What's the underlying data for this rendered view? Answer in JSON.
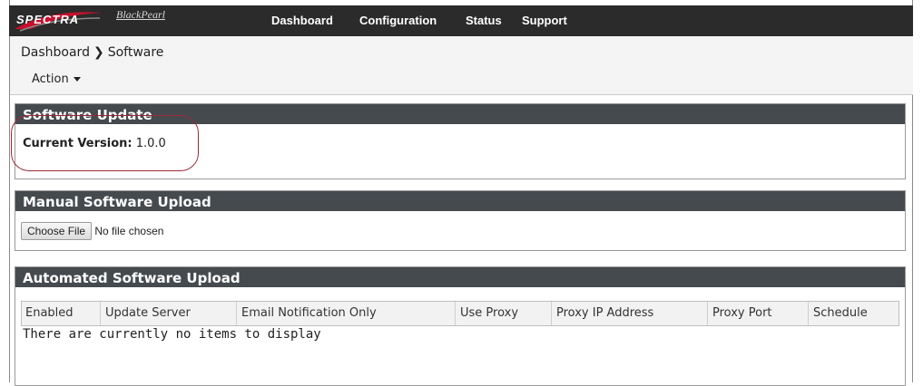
{
  "nav": {
    "brand": "SPECTRA",
    "product": "BlackPearl",
    "items": [
      "Dashboard",
      "Configuration",
      "Status",
      "Support"
    ]
  },
  "breadcrumb": {
    "root": "Dashboard",
    "separator": "❯",
    "current": "Software"
  },
  "action_menu": {
    "label": "Action"
  },
  "software_update": {
    "title": "Software Update",
    "current_version_label": "Current Version:",
    "current_version_value": "1.0.0"
  },
  "manual_upload": {
    "title": "Manual Software Upload",
    "choose_file_label": "Choose File",
    "file_status": "No file chosen"
  },
  "automated_upload": {
    "title": "Automated Software Upload",
    "columns": [
      "Enabled",
      "Update Server",
      "Email Notification Only",
      "Use Proxy",
      "Proxy IP Address",
      "Proxy Port",
      "Schedule"
    ],
    "empty_message": "There are currently no items to display"
  },
  "colors": {
    "navbar": "#2b2b2b",
    "panel_header": "#454a4f",
    "highlight": "#9c2a3a",
    "logo_red": "#c8102e"
  }
}
